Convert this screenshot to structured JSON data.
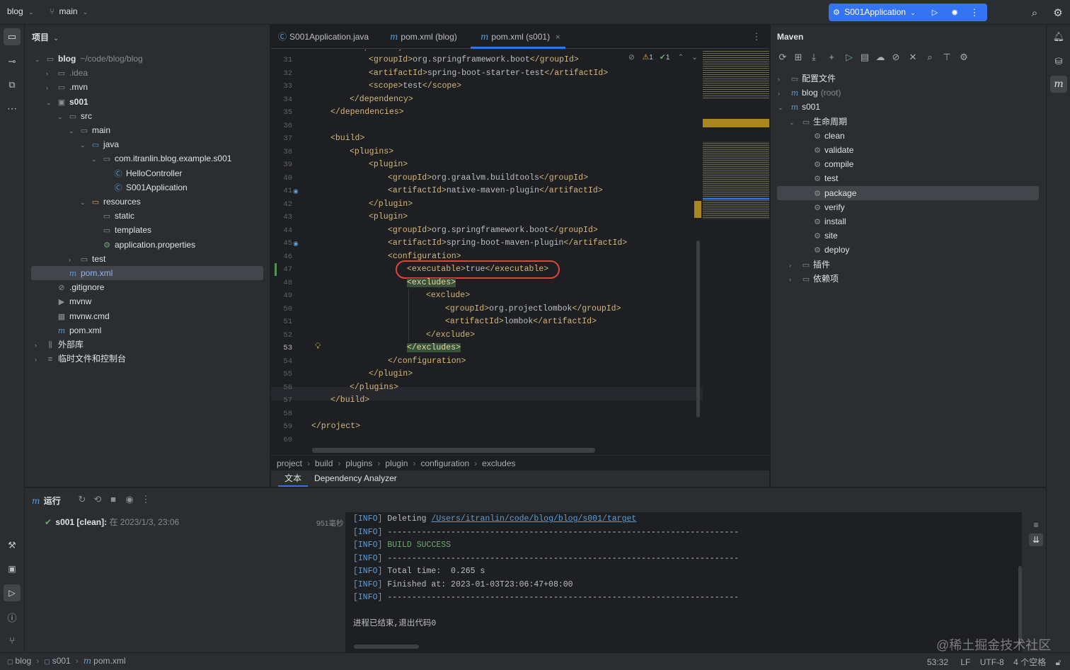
{
  "titlebar": {
    "project_name": "blog",
    "branch": "main",
    "run_config": "S001Application"
  },
  "project_panel": {
    "title": "项目",
    "tree": [
      {
        "label": "blog",
        "suffix": "~/code/blog/blog",
        "icon": "folder-icon",
        "depth": 0,
        "expanded": true,
        "bold": true
      },
      {
        "label": ".idea",
        "icon": "folder-icon",
        "depth": 1,
        "expanded": false,
        "dim": true
      },
      {
        "label": ".mvn",
        "icon": "folder-icon",
        "depth": 1,
        "expanded": false
      },
      {
        "label": "s001",
        "icon": "module-folder-icon",
        "depth": 1,
        "expanded": true,
        "bold": true
      },
      {
        "label": "src",
        "icon": "folder-icon",
        "depth": 2,
        "expanded": true
      },
      {
        "label": "main",
        "icon": "folder-icon",
        "depth": 3,
        "expanded": true
      },
      {
        "label": "java",
        "icon": "source-folder-icon",
        "depth": 4,
        "expanded": true
      },
      {
        "label": "com.itranlin.blog.example.s001",
        "icon": "package-icon",
        "depth": 5,
        "expanded": true
      },
      {
        "label": "HelloController",
        "icon": "class-icon",
        "depth": 6
      },
      {
        "label": "S001Application",
        "icon": "spring-class-icon",
        "depth": 6
      },
      {
        "label": "resources",
        "icon": "resources-folder-icon",
        "depth": 4,
        "expanded": true
      },
      {
        "label": "static",
        "icon": "folder-icon",
        "depth": 5
      },
      {
        "label": "templates",
        "icon": "folder-icon",
        "depth": 5
      },
      {
        "label": "application.properties",
        "icon": "properties-file-icon",
        "depth": 5
      },
      {
        "label": "test",
        "icon": "folder-icon",
        "depth": 3,
        "expanded": false
      },
      {
        "label": "pom.xml",
        "icon": "maven-file-icon",
        "depth": 2,
        "selected": true
      },
      {
        "label": ".gitignore",
        "icon": "ignore-file-icon",
        "depth": 1
      },
      {
        "label": "mvnw",
        "icon": "shell-file-icon",
        "depth": 1
      },
      {
        "label": "mvnw.cmd",
        "icon": "cmd-file-icon",
        "depth": 1
      },
      {
        "label": "pom.xml",
        "icon": "maven-file-icon",
        "depth": 1
      },
      {
        "label": "外部库",
        "icon": "library-icon",
        "depth": 0,
        "expanded": false
      },
      {
        "label": "临时文件和控制台",
        "icon": "scratches-icon",
        "depth": 0,
        "expanded": false
      }
    ]
  },
  "editor": {
    "tabs": [
      {
        "label": "S001Application.java",
        "icon": "spring-class-icon"
      },
      {
        "label": "pom.xml (blog)",
        "icon": "maven-file-icon"
      },
      {
        "label": "pom.xml (s001)",
        "icon": "maven-file-icon",
        "active": true
      }
    ],
    "inspection": {
      "warnings": "1",
      "ok": "1"
    },
    "first_line_partial": "<dependency>",
    "lines": [
      {
        "n": "31",
        "indent": 12,
        "text": "<groupId>org.springframework.boot</groupId>"
      },
      {
        "n": "32",
        "indent": 12,
        "text": "<artifactId>spring-boot-starter-test</artifactId>"
      },
      {
        "n": "33",
        "indent": 12,
        "text": "<scope>test</scope>"
      },
      {
        "n": "34",
        "indent": 8,
        "text": "</dependency>"
      },
      {
        "n": "35",
        "indent": 4,
        "text": "</dependencies>"
      },
      {
        "n": "36",
        "indent": 0,
        "text": ""
      },
      {
        "n": "37",
        "indent": 4,
        "text": "<build>"
      },
      {
        "n": "38",
        "indent": 8,
        "text": "<plugins>"
      },
      {
        "n": "39",
        "indent": 12,
        "text": "<plugin>"
      },
      {
        "n": "40",
        "indent": 16,
        "text": "<groupId>org.graalvm.buildtools</groupId>"
      },
      {
        "n": "41",
        "indent": 16,
        "text": "<artifactId>native-maven-plugin</artifactId>",
        "gutter": "maven"
      },
      {
        "n": "42",
        "indent": 12,
        "text": "</plugin>"
      },
      {
        "n": "43",
        "indent": 12,
        "text": "<plugin>"
      },
      {
        "n": "44",
        "indent": 16,
        "text": "<groupId>org.springframework.boot</groupId>"
      },
      {
        "n": "45",
        "indent": 16,
        "text": "<artifactId>spring-boot-maven-plugin</artifactId>",
        "gutter": "maven"
      },
      {
        "n": "46",
        "indent": 16,
        "text": "<configuration>"
      },
      {
        "n": "47",
        "indent": 20,
        "text": "<executable>true</executable>",
        "circled": true
      },
      {
        "n": "48",
        "indent": 20,
        "text": "<excludes>",
        "hl": true
      },
      {
        "n": "49",
        "indent": 24,
        "text": "<exclude>"
      },
      {
        "n": "50",
        "indent": 28,
        "text": "<groupId>org.projectlombok</groupId>"
      },
      {
        "n": "51",
        "indent": 28,
        "text": "<artifactId>lombok</artifactId>"
      },
      {
        "n": "52",
        "indent": 24,
        "text": "</exclude>"
      },
      {
        "n": "53",
        "indent": 20,
        "text": "</excludes>",
        "hl": true,
        "current": true
      },
      {
        "n": "54",
        "indent": 16,
        "text": "</configuration>"
      },
      {
        "n": "55",
        "indent": 12,
        "text": "</plugin>"
      },
      {
        "n": "56",
        "indent": 8,
        "text": "</plugins>"
      },
      {
        "n": "57",
        "indent": 4,
        "text": "</build>"
      },
      {
        "n": "58",
        "indent": 0,
        "text": ""
      },
      {
        "n": "59",
        "indent": 0,
        "text": "</project>"
      },
      {
        "n": "60",
        "indent": 0,
        "text": ""
      }
    ],
    "breadcrumbs": [
      "project",
      "build",
      "plugins",
      "plugin",
      "configuration",
      "excludes"
    ],
    "bottom_tabs": [
      {
        "label": "文本",
        "active": true
      },
      {
        "label": "Dependency Analyzer"
      }
    ]
  },
  "maven": {
    "title": "Maven",
    "tree": [
      {
        "label": "配置文件",
        "icon": "profiles-icon",
        "depth": 0,
        "expanded": false
      },
      {
        "label": "blog",
        "suffix": "(root)",
        "icon": "maven-icon",
        "depth": 0,
        "expanded": false
      },
      {
        "label": "s001",
        "icon": "maven-icon",
        "depth": 0,
        "expanded": true
      },
      {
        "label": "生命周期",
        "icon": "lifecycle-folder-icon",
        "depth": 1,
        "expanded": true
      },
      {
        "label": "clean",
        "icon": "gear-icon",
        "depth": 2
      },
      {
        "label": "validate",
        "icon": "gear-icon",
        "depth": 2
      },
      {
        "label": "compile",
        "icon": "gear-icon",
        "depth": 2
      },
      {
        "label": "test",
        "icon": "gear-icon",
        "depth": 2
      },
      {
        "label": "package",
        "icon": "gear-icon",
        "depth": 2,
        "selected": true
      },
      {
        "label": "verify",
        "icon": "gear-icon",
        "depth": 2
      },
      {
        "label": "install",
        "icon": "gear-icon",
        "depth": 2
      },
      {
        "label": "site",
        "icon": "gear-icon",
        "depth": 2
      },
      {
        "label": "deploy",
        "icon": "gear-icon",
        "depth": 2
      },
      {
        "label": "插件",
        "icon": "plugins-folder-icon",
        "depth": 1,
        "expanded": false
      },
      {
        "label": "依赖项",
        "icon": "dependencies-folder-icon",
        "depth": 1,
        "expanded": false
      }
    ]
  },
  "run": {
    "title": "运行",
    "item_label": "s001 [clean]:",
    "item_time": "在 2023/1/3, 23:06",
    "duration": "951毫秒",
    "console": [
      {
        "prefix": "[INFO]",
        "text": " Deleting ",
        "link": "/Users/itranlin/code/blog/blog/s001/target"
      },
      {
        "prefix": "[INFO]",
        "text": " ------------------------------------------------------------------------"
      },
      {
        "prefix": "[INFO]",
        "text": " ",
        "success": "BUILD SUCCESS"
      },
      {
        "prefix": "[INFO]",
        "text": " ------------------------------------------------------------------------"
      },
      {
        "prefix": "[INFO]",
        "text": " Total time:  0.265 s"
      },
      {
        "prefix": "[INFO]",
        "text": " Finished at: 2023-01-03T23:06:47+08:00"
      },
      {
        "prefix": "[INFO]",
        "text": " ------------------------------------------------------------------------"
      },
      {
        "prefix": "",
        "text": ""
      },
      {
        "prefix": "",
        "text": "进程已结束,退出代码0"
      }
    ]
  },
  "statusbar": {
    "crumbs": [
      "blog",
      "s001",
      "pom.xml"
    ],
    "position": "53:32",
    "line_sep": "LF",
    "encoding": "UTF-8",
    "indent": "4 个空格",
    "watermark": "@稀土掘金技术社区"
  },
  "colors": {
    "accent": "#3574f0",
    "selection": "#43454a",
    "tag": "#d5b778",
    "circle": "#e0443e",
    "success": "#6aab73"
  }
}
